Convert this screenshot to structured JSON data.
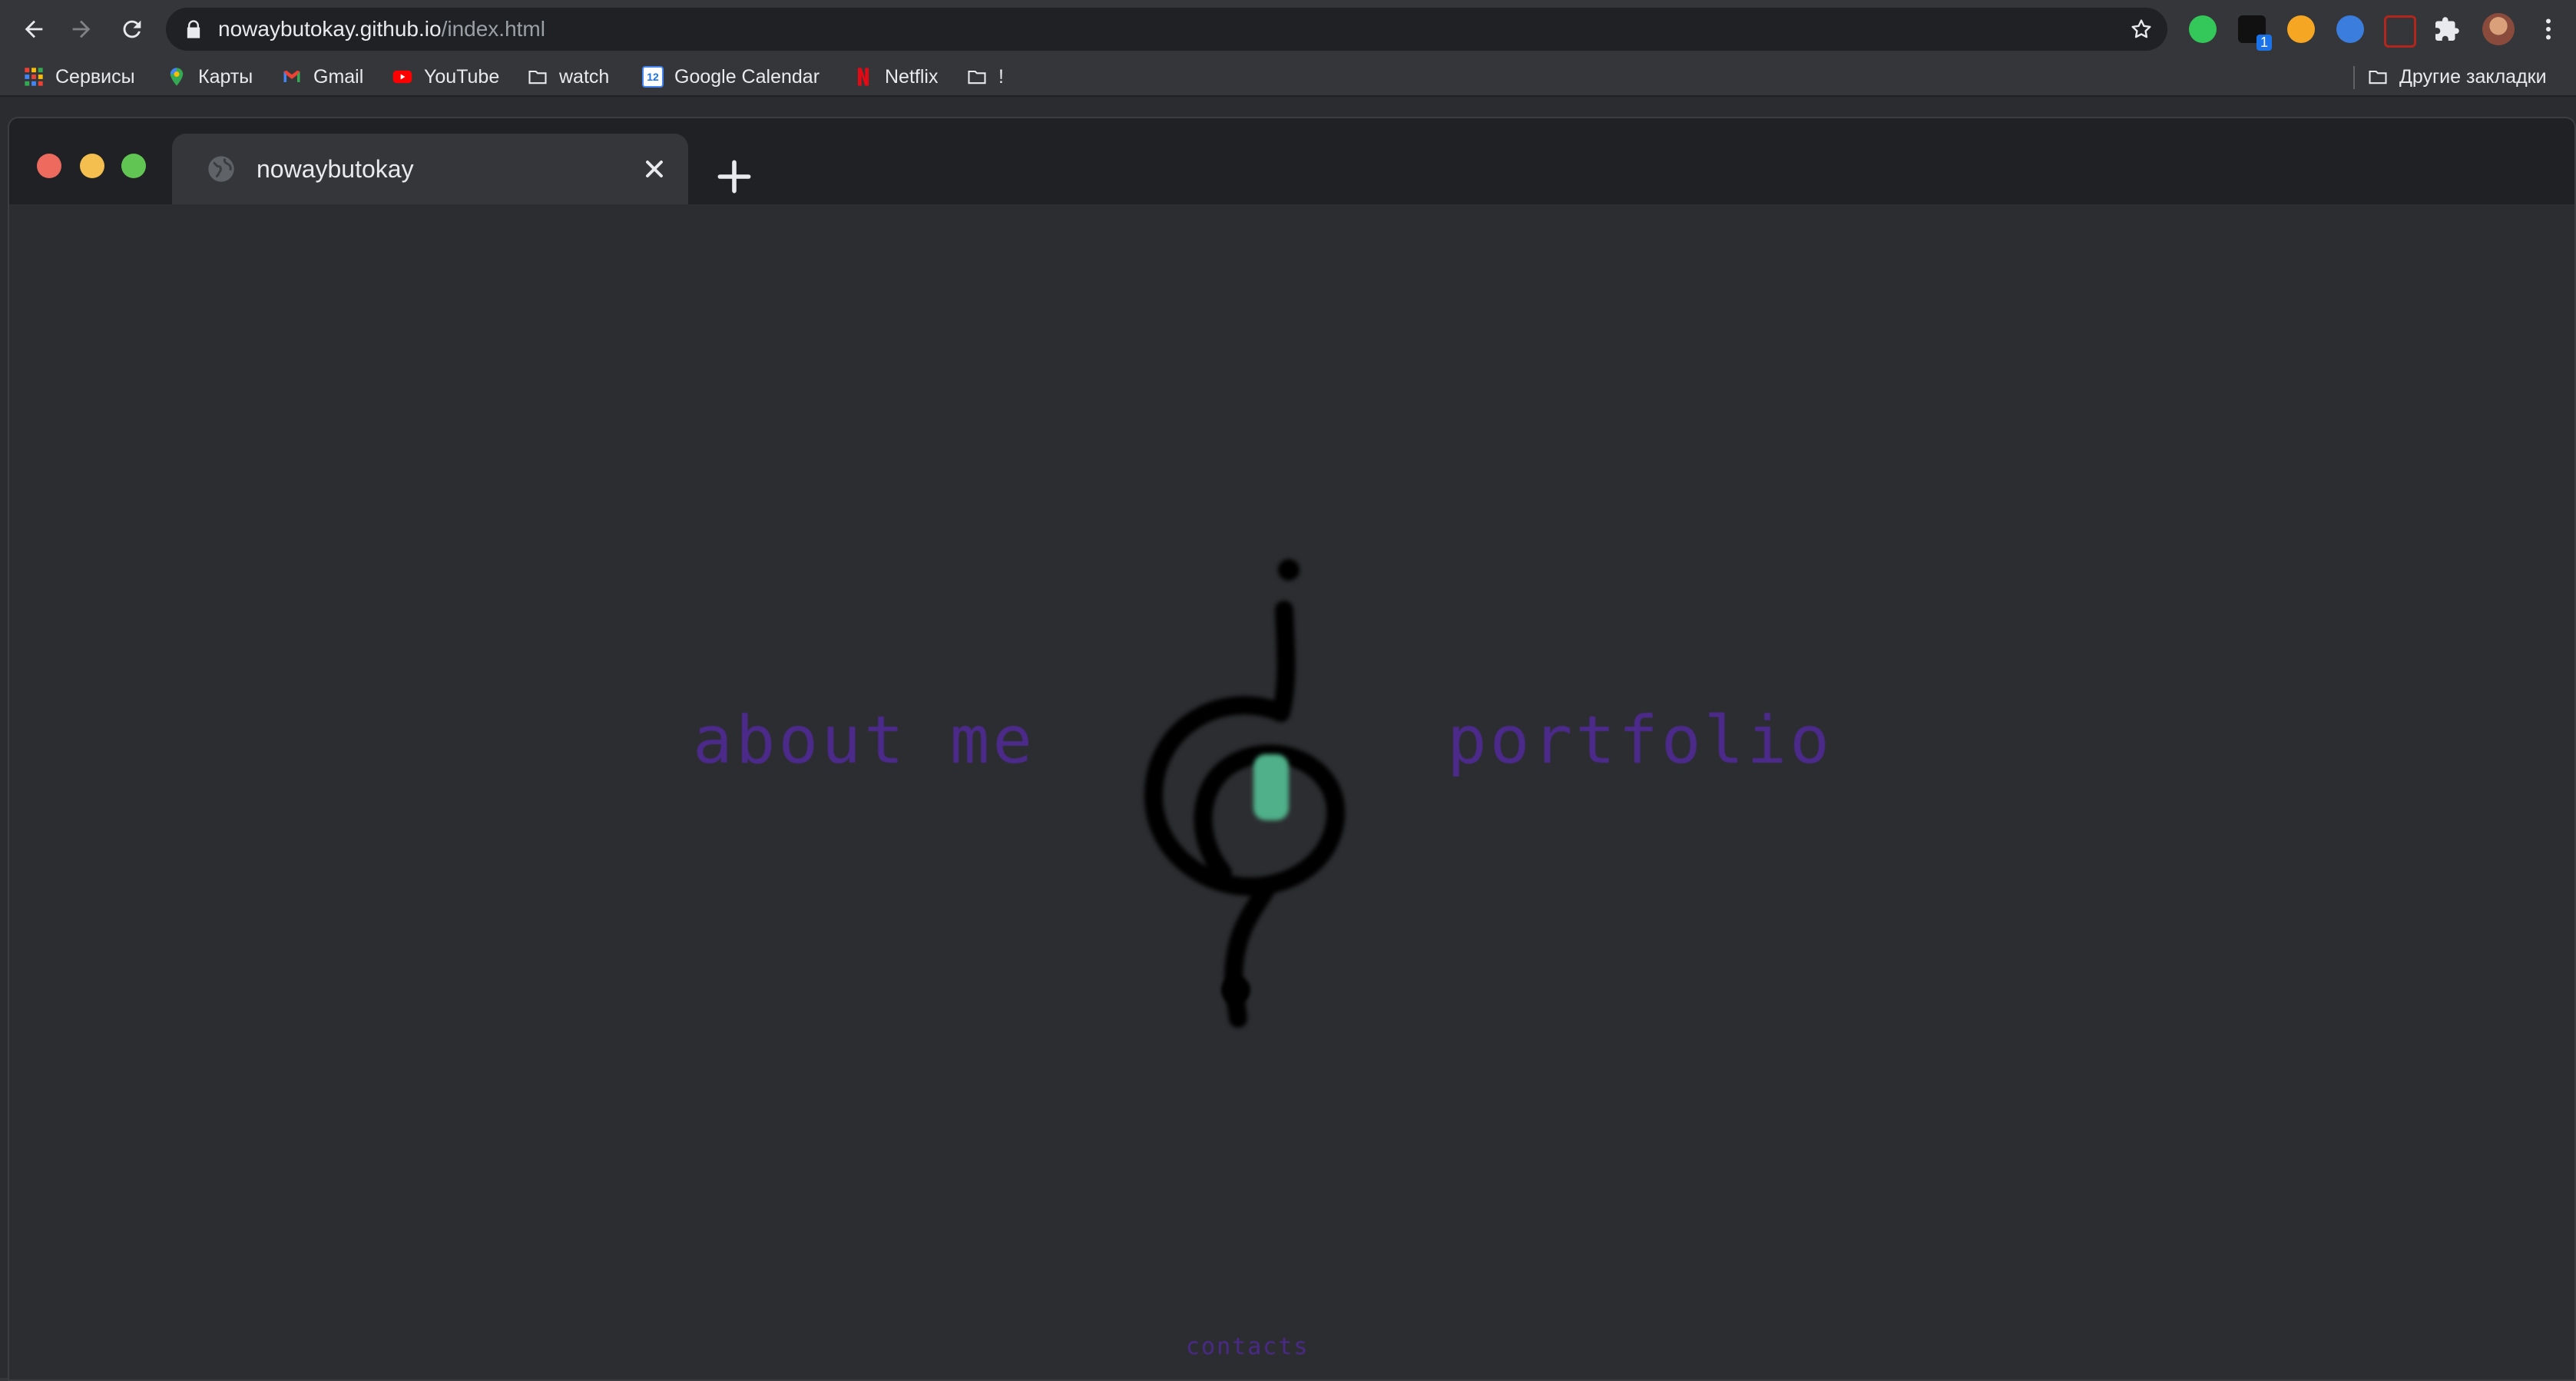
{
  "browser": {
    "url_host": "nowaybutokay.github.io",
    "url_path": "/index.html",
    "extension_badge": "1",
    "colors": {
      "toolbar": "#35363a",
      "omnibox": "#202124",
      "text": "#e8eaed",
      "text_dim": "#9aa0a6"
    }
  },
  "bookmarks": {
    "items": [
      {
        "label": "Сервисы",
        "icon": "apps-grid-icon"
      },
      {
        "label": "Карты",
        "icon": "maps-pin-icon"
      },
      {
        "label": "Gmail",
        "icon": "gmail-icon"
      },
      {
        "label": "YouTube",
        "icon": "youtube-icon"
      },
      {
        "label": "watch",
        "icon": "folder-icon"
      },
      {
        "label": "Google Calendar",
        "icon": "calendar-icon"
      },
      {
        "label": "Netflix",
        "icon": "netflix-icon"
      },
      {
        "label": "!",
        "icon": "folder-icon"
      }
    ],
    "other": "Другие закладки",
    "calendar_day": "12"
  },
  "inner_browser": {
    "tab_title": "nowaybutokay",
    "traffic_colors": [
      "#ed6a5e",
      "#f4bf4f",
      "#61c554"
    ]
  },
  "page": {
    "nav": {
      "about": "about me",
      "portfolio": "portfolio",
      "contacts": "contacts"
    },
    "colors": {
      "link": "#4b2a8a",
      "logo_stroke": "#000000",
      "eye": "#4fb08a",
      "background": "#2c2d30"
    }
  }
}
